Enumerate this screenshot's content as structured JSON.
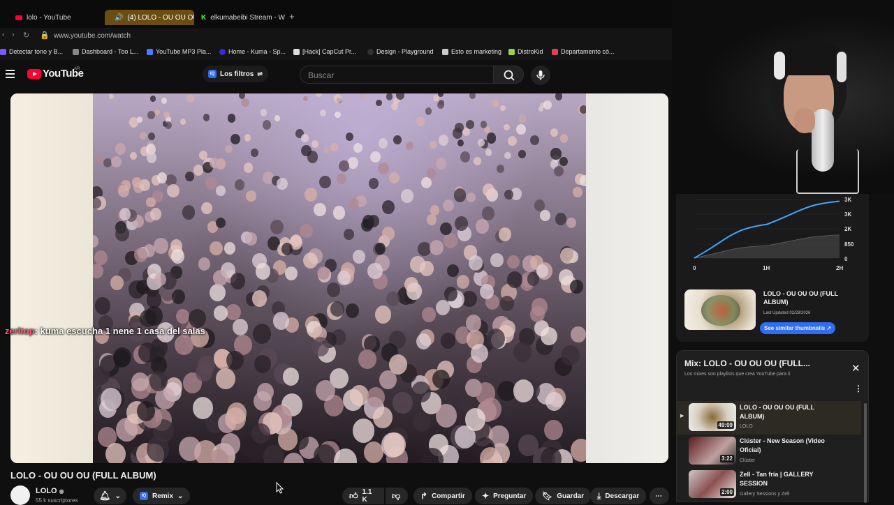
{
  "browser": {
    "tabs": [
      {
        "label": "lolo - YouTube",
        "icon": "youtube-icon"
      },
      {
        "label": "(4) LOLO - OU OU OU",
        "icon": "youtube-icon",
        "active": true
      },
      {
        "label": "elkumabeibi Stream - Wat",
        "icon": "kick-icon"
      }
    ],
    "new_tab": "+",
    "url": "www.youtube.com/watch",
    "bookmarks": [
      {
        "label": "Detectar tono y B...",
        "color": "#7a5af8"
      },
      {
        "label": "Dashboard - Too L...",
        "color": "#888888"
      },
      {
        "label": "YouTube MP3 Pla...",
        "color": "#4a7bff"
      },
      {
        "label": "Home - Kuma - Sp...",
        "color": "#3b2ad9"
      },
      {
        "label": "[Hack] CapCut Pr...",
        "color": "#dddddd"
      },
      {
        "label": "Design - Playground",
        "color": "#333333"
      },
      {
        "label": "Esto es marketing",
        "color": "#cccccc"
      },
      {
        "label": "DistroKid",
        "color": "#9ad24a"
      },
      {
        "label": "Departamento có...",
        "color": "#e0405a"
      }
    ]
  },
  "youtube": {
    "logo_text": "YouTube",
    "country": "AR",
    "filters_label": "Los filtros",
    "search_placeholder": "Buscar",
    "chat_user": "zeritop",
    "chat_message": ": kuma escucha 1 nene 1 casa del salas",
    "video_title": "LOLO - OU OU OU (FULL ALBUM)",
    "channel_name": "LOLO",
    "channel_subs": "55 k suscriptores",
    "remix_label": "Remix",
    "likes": "1.1 K",
    "share_label": "Compartir",
    "ask_label": "Preguntar",
    "save_label": "Guardar",
    "download_label": "Descargar"
  },
  "stats_panel": {
    "chart_data": {
      "type": "area",
      "x": [
        "0",
        "1H",
        "2H"
      ],
      "y_ticks": [
        "3K",
        "3K",
        "2K",
        "850",
        "0"
      ],
      "series": [
        {
          "values": [
            0,
            1900,
            3200
          ],
          "color": "#3ea6ff"
        },
        {
          "values": [
            0,
            700,
            1300
          ],
          "color": "#5a5a5a"
        }
      ]
    },
    "title": "LOLO - OU OU OU (FULL ALBUM)",
    "updated": "Last Updated 02/28/2026",
    "similar_button": "See similar thumbnails ↗"
  },
  "mix": {
    "title": "Mix: LOLO - OU OU OU (FULL...",
    "subtitle": "Los mixes son playlists que crea YouTube para ti",
    "items": [
      {
        "title": "LOLO - OU OU OU (FULL ALBUM)",
        "channel": "LOLO",
        "duration": "49:09",
        "current": true
      },
      {
        "title": "Clúster - New Season (Video Oficial)",
        "channel": "Clúster",
        "duration": "3:22"
      },
      {
        "title": "Zell - Tan fría | GALLERY SESSION",
        "channel": "Gallery Sessions y Zell",
        "duration": "2:00"
      }
    ]
  }
}
